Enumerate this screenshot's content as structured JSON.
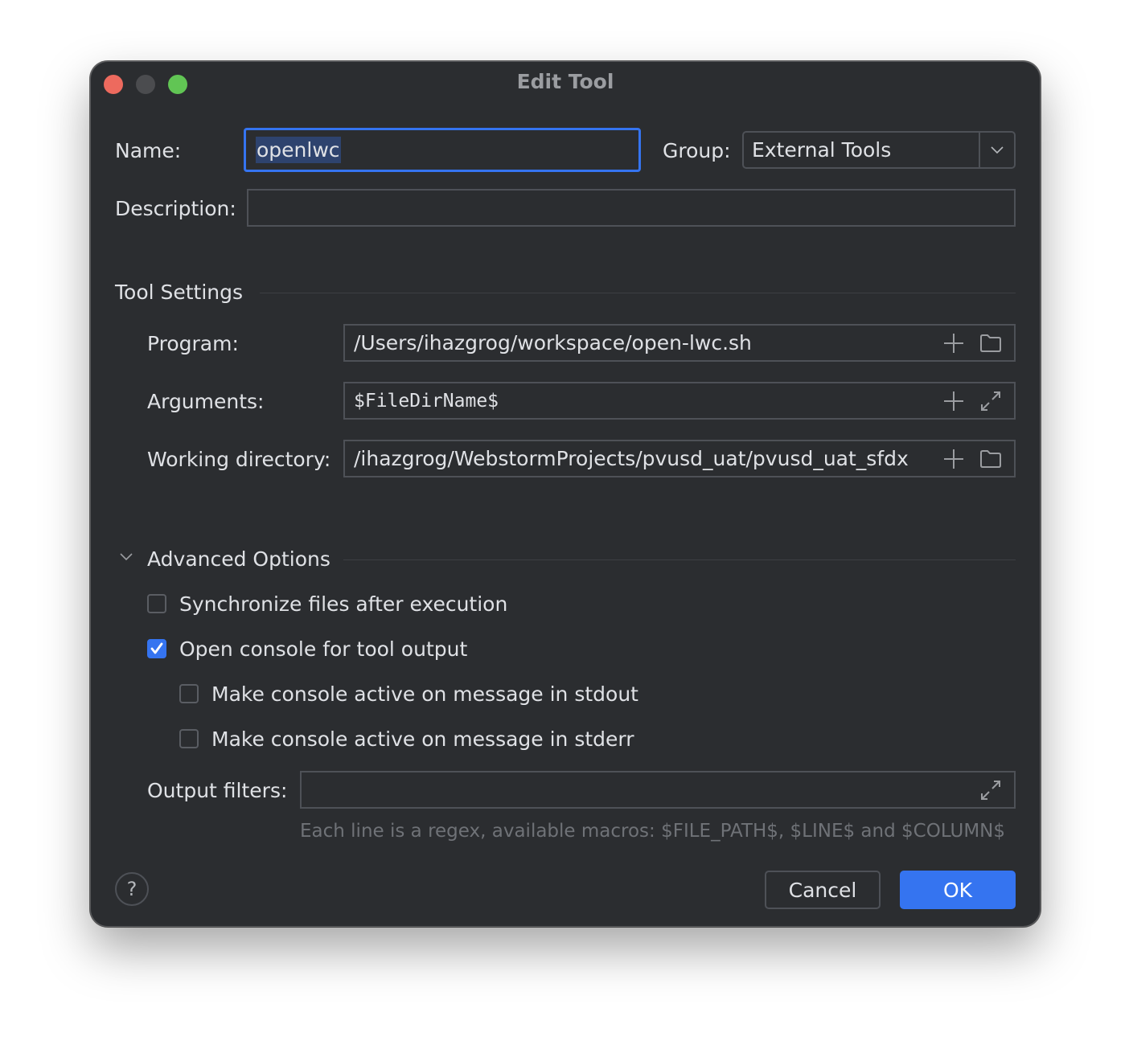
{
  "window": {
    "title": "Edit Tool"
  },
  "form": {
    "name_label": "Name:",
    "name_value": "openlwc",
    "group_label": "Group:",
    "group_value": "External Tools",
    "description_label": "Description:",
    "description_value": ""
  },
  "tool_settings": {
    "title": "Tool Settings",
    "program_label": "Program:",
    "program_value": "/Users/ihazgrog/workspace/open-lwc.sh",
    "arguments_label": "Arguments:",
    "arguments_value": "$FileDirName$",
    "working_dir_label": "Working directory:",
    "working_dir_value": "/ihazgrog/WebstormProjects/pvusd_uat/pvusd_uat_sfdx"
  },
  "advanced": {
    "title": "Advanced Options",
    "expanded": true,
    "options": [
      {
        "label": "Synchronize files after execution",
        "checked": false
      },
      {
        "label": "Open console for tool output",
        "checked": true
      },
      {
        "label": "Make console active on message in stdout",
        "checked": false
      },
      {
        "label": "Make console active on message in stderr",
        "checked": false
      }
    ],
    "output_filters_label": "Output filters:",
    "output_filters_value": "",
    "output_filters_hint": "Each line is a regex, available macros: $FILE_PATH$, $LINE$ and $COLUMN$"
  },
  "footer": {
    "help_label": "?",
    "cancel_label": "Cancel",
    "ok_label": "OK"
  },
  "colors": {
    "background": "#2b2d30",
    "accent": "#3574f0",
    "text": "#dfe1e5",
    "hint": "#6f7277"
  }
}
